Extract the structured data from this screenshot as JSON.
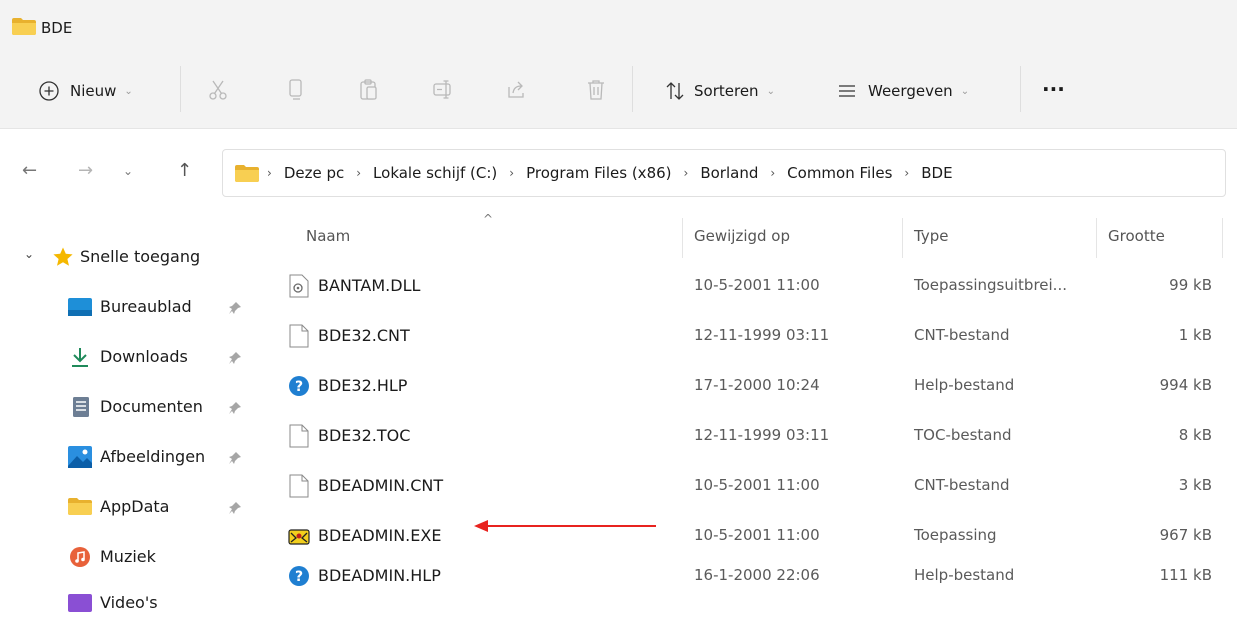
{
  "window": {
    "title": "BDE"
  },
  "toolbar": {
    "new_label": "Nieuw",
    "sort_label": "Sorteren",
    "view_label": "Weergeven",
    "more_label": "···"
  },
  "address": {
    "crumbs": [
      "Deze pc",
      "Lokale schijf (C:)",
      "Program Files (x86)",
      "Borland",
      "Common Files",
      "BDE"
    ],
    "separator": "›"
  },
  "sidebar": {
    "items": [
      {
        "label": "Snelle toegang",
        "icon": "star-icon"
      },
      {
        "label": "Bureaublad",
        "icon": "desktop-icon"
      },
      {
        "label": "Downloads",
        "icon": "download-icon"
      },
      {
        "label": "Documenten",
        "icon": "document-icon"
      },
      {
        "label": "Afbeeldingen",
        "icon": "pictures-icon"
      },
      {
        "label": "AppData",
        "icon": "folder-icon"
      },
      {
        "label": "Muziek",
        "icon": "music-icon"
      },
      {
        "label": "Video's",
        "icon": "video-icon"
      }
    ]
  },
  "columns": {
    "name": "Naam",
    "modified": "Gewijzigd op",
    "type": "Type",
    "size": "Grootte"
  },
  "files": [
    {
      "name": "BANTAM.DLL",
      "modified": "10-5-2001 11:00",
      "type": "Toepassingsuitbrei...",
      "size": "99 kB",
      "icon": "dll-icon"
    },
    {
      "name": "BDE32.CNT",
      "modified": "12-11-1999 03:11",
      "type": "CNT-bestand",
      "size": "1 kB",
      "icon": "file-icon"
    },
    {
      "name": "BDE32.HLP",
      "modified": "17-1-2000 10:24",
      "type": "Help-bestand",
      "size": "994 kB",
      "icon": "help-icon"
    },
    {
      "name": "BDE32.TOC",
      "modified": "12-11-1999 03:11",
      "type": "TOC-bestand",
      "size": "8 kB",
      "icon": "file-icon"
    },
    {
      "name": "BDEADMIN.CNT",
      "modified": "10-5-2001 11:00",
      "type": "CNT-bestand",
      "size": "3 kB",
      "icon": "file-icon"
    },
    {
      "name": "BDEADMIN.EXE",
      "modified": "10-5-2001 11:00",
      "type": "Toepassing",
      "size": "967 kB",
      "icon": "exe-icon"
    },
    {
      "name": "BDEADMIN.HLP",
      "modified": "16-1-2000 22:06",
      "type": "Help-bestand",
      "size": "111 kB",
      "icon": "help-icon"
    }
  ],
  "colors": {
    "accent": "#0067c0",
    "folder": "#f8c73a",
    "annotation_arrow": "#e8231f"
  }
}
